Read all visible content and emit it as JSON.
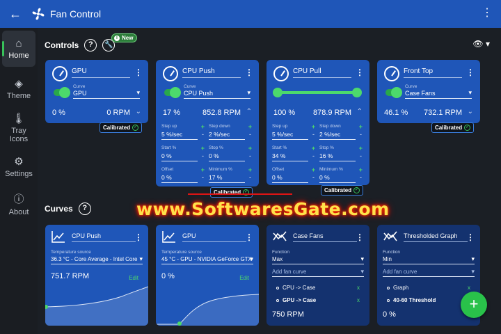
{
  "app": {
    "title": "Fan Control"
  },
  "sidebar": {
    "items": [
      {
        "label": "Home"
      },
      {
        "label": "Theme"
      },
      {
        "label": "Tray Icons"
      },
      {
        "label": "Settings"
      },
      {
        "label": "About"
      }
    ]
  },
  "controls_section": {
    "title": "Controls",
    "badge": "New"
  },
  "curves_section": {
    "title": "Curves"
  },
  "watermark": "www.SoftwaresGate.com",
  "controls": [
    {
      "name": "GPU",
      "curve_label": "Curve",
      "curve": "GPU",
      "percent": "0 %",
      "rpm": "0 RPM",
      "calibrated": "Calibrated"
    },
    {
      "name": "CPU Push",
      "curve_label": "Curve",
      "curve": "CPU Push",
      "percent": "17 %",
      "rpm": "852.8 RPM",
      "calibrated": "Calibrated",
      "params": {
        "step_up_label": "Step up",
        "step_up": "5 %/sec",
        "step_down_label": "Step down",
        "step_down": "2 %/sec",
        "start_label": "Start %",
        "start": "0 %",
        "stop_label": "Stop %",
        "stop": "0 %",
        "offset_label": "Offset",
        "offset": "0 %",
        "minimum_label": "Minimum %",
        "minimum": "17 %"
      }
    },
    {
      "name": "CPU Pull",
      "percent": "100 %",
      "rpm": "878.9 RPM",
      "calibrated": "Calibrated",
      "params": {
        "step_up_label": "Step up",
        "step_up": "5 %/sec",
        "step_down_label": "Step down",
        "step_down": "2 %/sec",
        "start_label": "Start %",
        "start": "34 %",
        "stop_label": "Stop %",
        "stop": "16 %",
        "offset_label": "Offset",
        "offset": "0 %",
        "minimum_label": "Minimum %",
        "minimum": "0 %"
      }
    },
    {
      "name": "Front Top",
      "curve_label": "Curve",
      "curve": "Case Fans",
      "percent": "46.1 %",
      "rpm": "732.1 RPM",
      "calibrated": "Calibrated"
    }
  ],
  "curves": [
    {
      "name": "CPU Push",
      "source_label": "Temperature source",
      "source": "36.3 °C - Core Average - Intel Core",
      "value": "751.7 RPM",
      "edit": "Edit"
    },
    {
      "name": "GPU",
      "source_label": "Temperature source",
      "source": "45 °C - GPU - NVIDIA GeForce GTX",
      "value": "0 %",
      "edit": "Edit"
    },
    {
      "name": "Case Fans",
      "function_label": "Function",
      "function": "Max",
      "add_placeholder": "Add fan curve",
      "items": [
        {
          "label": "CPU -> Case",
          "remove": "x"
        },
        {
          "label": "GPU -> Case",
          "remove": "x"
        }
      ],
      "value": "750 RPM"
    },
    {
      "name": "Thresholded Graph",
      "function_label": "Function",
      "function": "Min",
      "add_placeholder": "Add fan curve",
      "items": [
        {
          "label": "Graph",
          "remove": "x"
        },
        {
          "label": "40-60 Threshold",
          "remove": "x"
        }
      ],
      "value": "0 %"
    }
  ],
  "icons": {
    "back": "back-arrow-icon",
    "logo": "fan-logo-icon",
    "menu": "more-vertical-icon",
    "home": "home-icon",
    "theme": "paint-bucket-icon",
    "tray": "thermometer-icon",
    "settings": "gear-icon",
    "about": "info-icon",
    "visibility": "eye-icon",
    "add": "plus-icon",
    "calibrated": "check-circle-icon"
  },
  "colors": {
    "accent": "#1f56b8",
    "success": "#38c25a",
    "fab": "#29c24a",
    "background": "#1b1f25"
  }
}
